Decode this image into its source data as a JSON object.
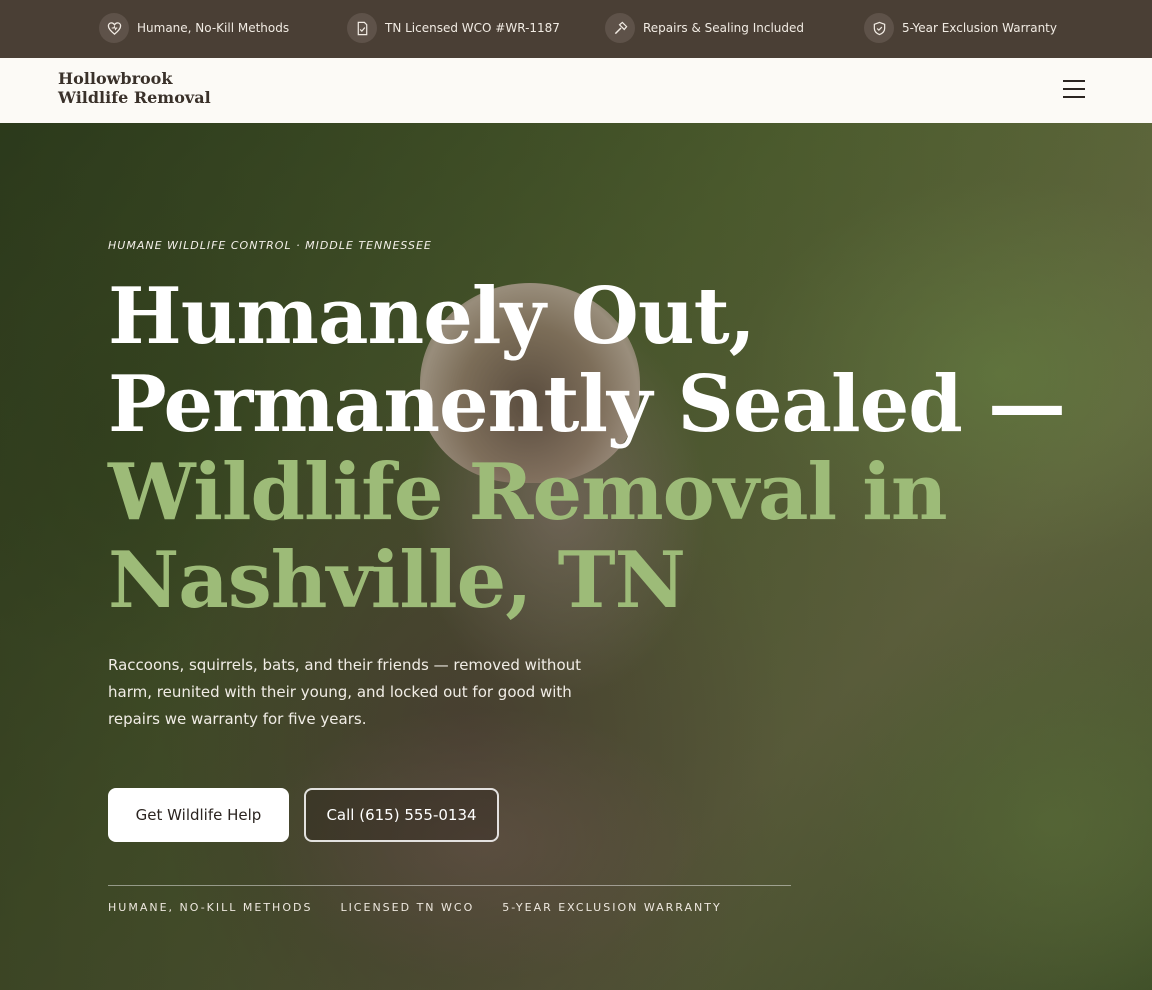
{
  "topbar": {
    "items": [
      {
        "icon": "heart-shield-icon",
        "label": "Humane, No-Kill Methods"
      },
      {
        "icon": "document-check-icon",
        "label": "TN Licensed WCO #WR-1187"
      },
      {
        "icon": "hammer-icon",
        "label": "Repairs & Sealing Included"
      },
      {
        "icon": "shield-check-icon",
        "label": "5-Year Exclusion Warranty"
      }
    ]
  },
  "header": {
    "brand": "Hollowbrook Wildlife Removal",
    "menu_icon": "hamburger-menu-icon"
  },
  "hero": {
    "eyebrow": "HUMANE WILDLIFE CONTROL · MIDDLE TENNESSEE",
    "headline_part1": "Humanely Out, Permanently Sealed — ",
    "headline_accent": "Wildlife Removal in Nashville, TN",
    "lede": "Raccoons, squirrels, bats, and their friends — removed without harm, reunited with their young, and locked out for good with repairs we warranty for five years.",
    "primary_cta": "Get Wildlife Help",
    "secondary_cta": "Call (615) 555-0134",
    "trust_items": [
      "HUMANE, NO-KILL METHODS",
      "LICENSED TN WCO",
      "5-YEAR EXCLUSION WARRANTY"
    ]
  },
  "colors": {
    "topbar_bg": "#4a3f35",
    "header_bg": "#fcfaf6",
    "accent_green": "#9dbb78"
  }
}
